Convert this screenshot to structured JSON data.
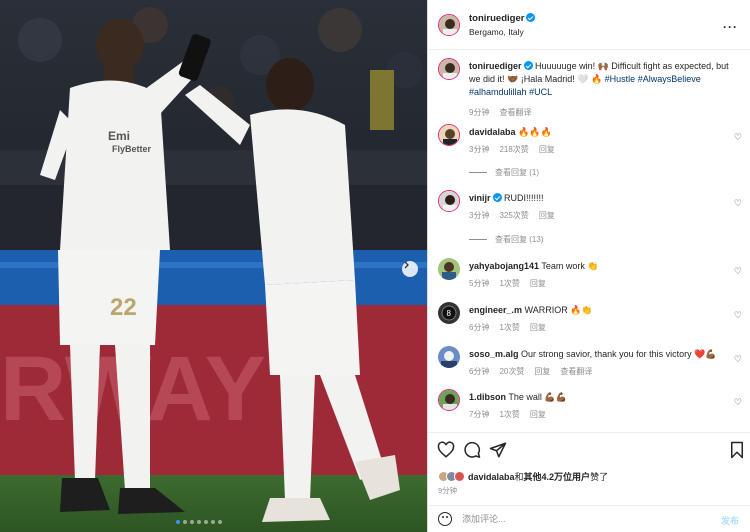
{
  "post": {
    "username": "toniruediger",
    "location": "Bergamo, Italy",
    "caption": {
      "username": "toniruediger",
      "text_a": "Huuuuuge win! 🙌🏾 Difficult fight as expected, but we did it! 🤝🏾 ¡Hala Madrid! 🤍 🔥 ",
      "tag1": "#Hustle",
      "tag2": "#AlwaysBelieve",
      "tag3": "#alhamdulillah",
      "tag4": "#UCL",
      "time": "9分钟",
      "translate": "查看翻译"
    },
    "likes": {
      "user": "davidalaba",
      "text": "和",
      "other_count": "其他4.2万位用户",
      "suffix": "赞了"
    },
    "time_ago": "9分钟"
  },
  "comments": [
    {
      "user": "davidalaba",
      "text": "🔥🔥🔥",
      "time": "3分钟",
      "likes": "218次赞",
      "reply": "回复",
      "view_replies": "查看回复 (1)"
    },
    {
      "user": "vinijr",
      "text": "RUDI!!!!!!!",
      "time": "3分钟",
      "likes": "325次赞",
      "reply": "回复",
      "view_replies": "查看回复 (13)"
    },
    {
      "user": "yahyabojang141",
      "text": "Team work 👏",
      "time": "5分钟",
      "likes": "1次赞",
      "reply": "回复"
    },
    {
      "user": "engineer_.m",
      "text": "WARRIOR 🔥👏",
      "time": "6分钟",
      "likes": "1次赞",
      "reply": "回复"
    },
    {
      "user": "soso_m.alg",
      "text": "Our strong savior, thank you for this victory ❤️💪🏾",
      "time": "6分钟",
      "likes": "20次赞",
      "reply": "回复",
      "translate": "查看翻译"
    },
    {
      "user": "1.dibson",
      "text": "The wall 💪🏾💪🏾",
      "time": "7分钟",
      "likes": "1次赞",
      "reply": "回复"
    }
  ],
  "add_comment": {
    "placeholder": "添加评论...",
    "post_label": "发布"
  },
  "photo": {
    "jersey_number": "22",
    "jersey_sponsor_line1": "Emi",
    "jersey_sponsor_line2": "FlyBetter",
    "board_text": "RWAY"
  },
  "colors": {
    "accent": "#0095f6",
    "link": "#00376b",
    "muted": "#8e8e8e",
    "heart_red": "#ed4956"
  },
  "icons": [
    "heart-icon",
    "comment-icon",
    "share-icon",
    "bookmark-icon",
    "more-icon",
    "verified-icon",
    "emoji-icon",
    "chevron-right-icon"
  ]
}
